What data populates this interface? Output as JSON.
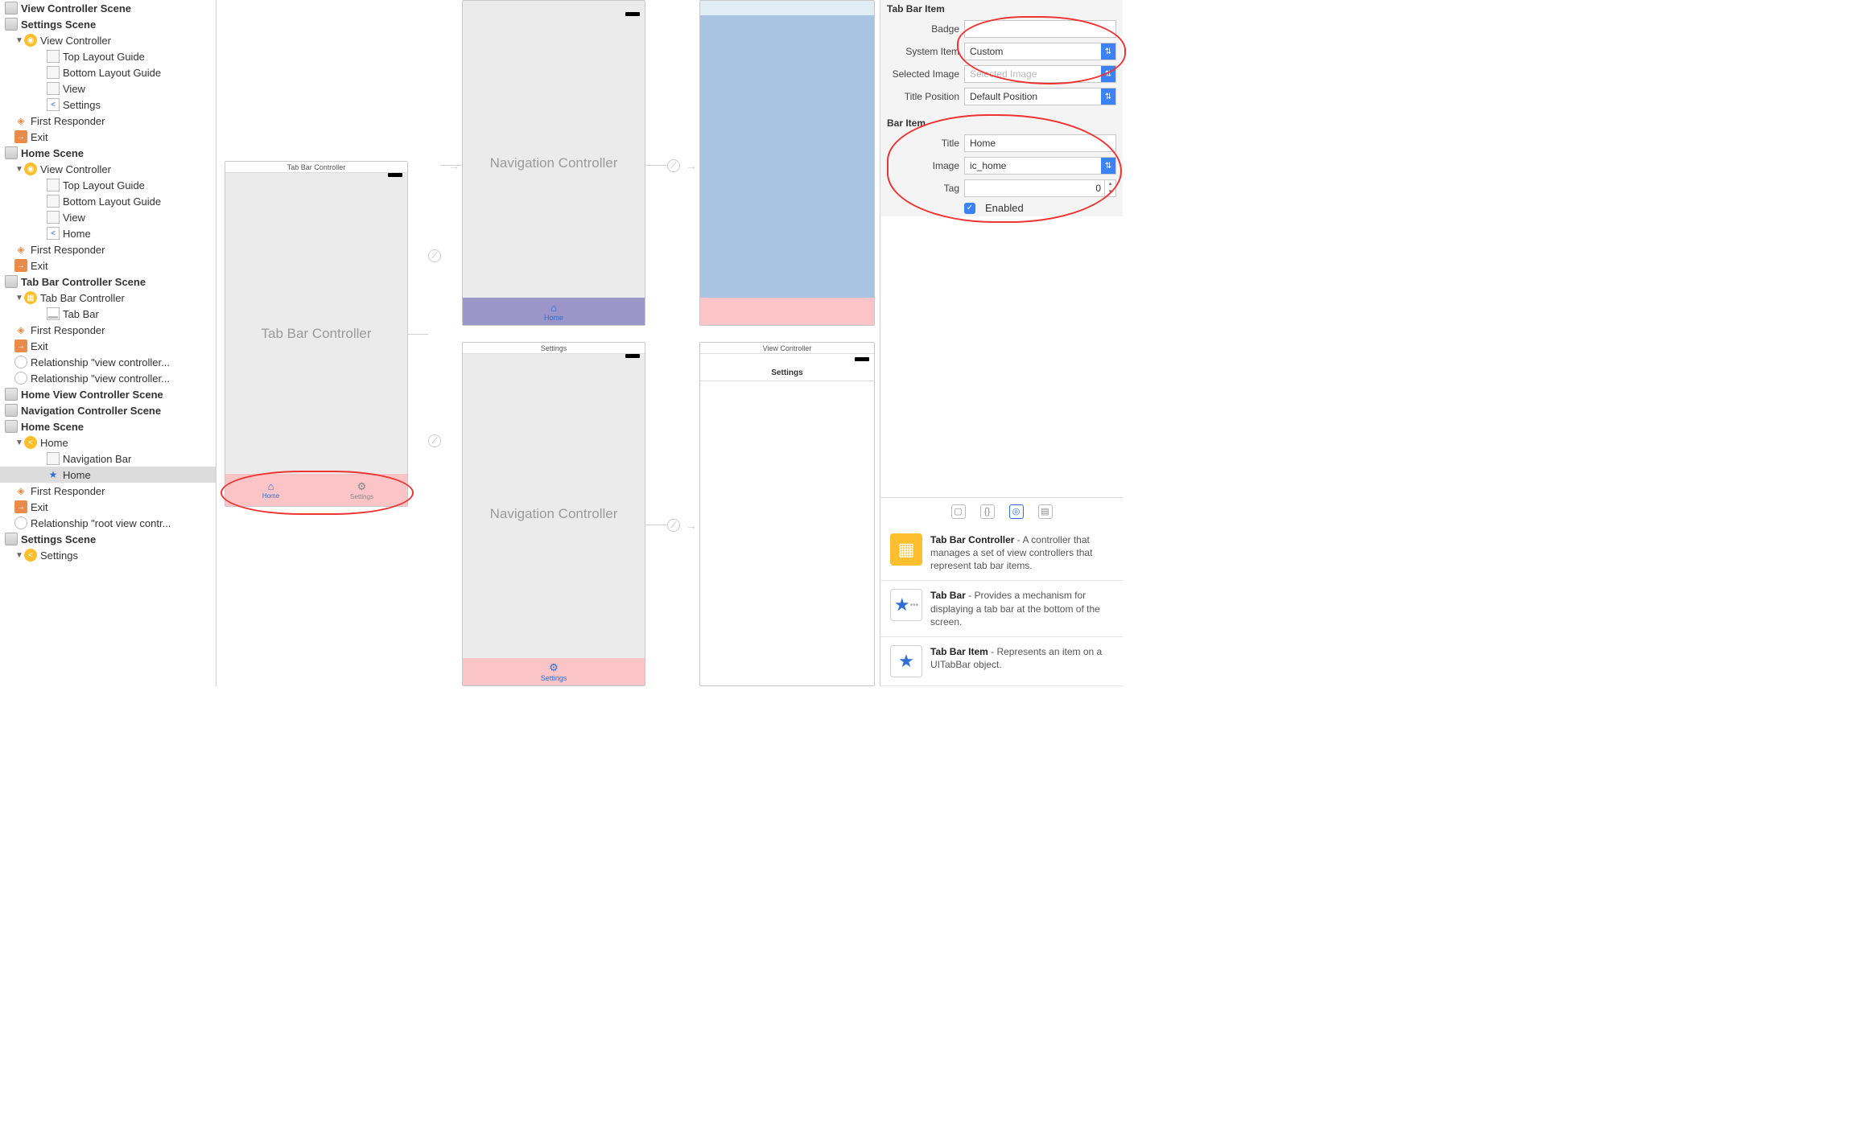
{
  "outline": {
    "scene1": "View Controller Scene",
    "scene2": "Settings Scene",
    "vc": "View Controller",
    "top_guide": "Top Layout Guide",
    "bottom_guide": "Bottom Layout Guide",
    "view": "View",
    "settings": "Settings",
    "first_responder": "First Responder",
    "exit": "Exit",
    "home_scene": "Home Scene",
    "home": "Home",
    "tabbar_scene": "Tab Bar Controller Scene",
    "tabbar_ctrl": "Tab Bar Controller",
    "tab_bar": "Tab Bar",
    "rel_vc": "Relationship \"view controller...",
    "home_vc_scene": "Home View Controller Scene",
    "nav_scene": "Navigation Controller Scene",
    "nav_bar": "Navigation Bar",
    "rel_root": "Relationship \"root view contr...",
    "settings_scene2": "Settings Scene",
    "settings2": "Settings"
  },
  "canvas": {
    "tabbar_title": "Tab Bar Controller",
    "tabbar_label": "Tab Bar Controller",
    "nav_label": "Navigation Controller",
    "settings_title": "Settings",
    "view_controller_title": "View Controller",
    "home_tab": "Home",
    "settings_tab": "Settings",
    "vc_home_top": "Home",
    "vc_settings_top": "Settings"
  },
  "inspector": {
    "section1": "Tab Bar Item",
    "badge_label": "Badge",
    "badge_value": "",
    "system_item_label": "System Item",
    "system_item_value": "Custom",
    "selected_image_label": "Selected Image",
    "selected_image_placeholder": "Selected Image",
    "title_position_label": "Title Position",
    "title_position_value": "Default Position",
    "section2": "Bar Item",
    "title_label": "Title",
    "title_value": "Home",
    "image_label": "Image",
    "image_value": "ic_home",
    "tag_label": "Tag",
    "tag_value": "0",
    "enabled_label": "Enabled"
  },
  "library": {
    "item1_title": "Tab Bar Controller",
    "item1_desc": " - A controller that manages a set of view controllers that represent tab bar items.",
    "item2_title": "Tab Bar",
    "item2_desc": " - Provides a mechanism for displaying a tab bar at the bottom of the screen.",
    "item3_title": "Tab Bar Item",
    "item3_desc": " - Represents an item on a UITabBar object."
  }
}
